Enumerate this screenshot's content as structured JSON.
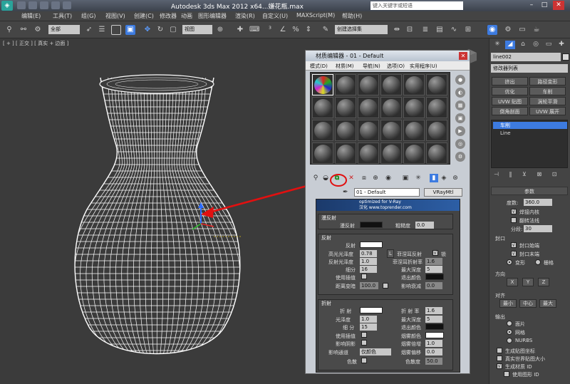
{
  "titlebar": {
    "title": "Autodesk 3ds Max  2012 x64",
    "title_tail": "...嫌花瓶.max",
    "search_placeholder": "键入关键字或短语"
  },
  "menubar": [
    "编辑(E)",
    "工具(T)",
    "组(G)",
    "视图(V)",
    "创建(C)",
    "修改器",
    "动画",
    "图形编辑器",
    "渲染(R)",
    "自定义(U)",
    "MAXScript(M)",
    "帮助(H)"
  ],
  "toolbar": {
    "selection_filter": "全部",
    "ref_coord": "视图",
    "named_sel": "创建选择集"
  },
  "viewport": {
    "label": "[ + ] [ 正交 ] [ 真实 + 边面 ]"
  },
  "material_editor": {
    "title": "材质编辑器 - 01 - Default",
    "menu": [
      "模式(D)",
      "材质(M)",
      "导航(N)",
      "选项(O)",
      "实用程序(U)"
    ],
    "material_name": "01 - Default",
    "material_type": "VRayMtl",
    "banner_line1": "optimized for V-Ray",
    "banner_line2": "汉化 www.toprender.com",
    "diffuse": {
      "header": "漫反射",
      "diffuse_label": "漫反射",
      "roughness_label": "粗糙度",
      "roughness_value": "0.0"
    },
    "reflection": {
      "header": "反射",
      "reflect_label": "反射",
      "hilight_gloss_label": "高光光泽度",
      "hilight_gloss_value": "0.78",
      "fresnel_label": "菲涅耳反射",
      "fresnel_check": "√",
      "lock_label": "L",
      "lock_label2": "锁",
      "refl_gloss_label": "反射光泽度",
      "refl_gloss_value": "1.0",
      "fresnel_ior_label": "菲涅耳折射率",
      "fresnel_ior_value": "1.6",
      "subdivs_label": "细分",
      "subdivs_value": "16",
      "max_depth_label": "最大深度",
      "max_depth_value": "5",
      "use_interp_label": "使用插值",
      "exit_color_label": "退出颜色",
      "dim_dist_label": "距离变暗",
      "dim_dist_value": "100.0",
      "dim_falloff_label": "影响衰减",
      "dim_falloff_value": "0.0"
    },
    "refraction": {
      "header": "折射",
      "refract_label": "折 射",
      "ior_label": "折 射 率",
      "ior_value": "1.6",
      "gloss_label": "光泽度",
      "gloss_value": "1.0",
      "max_depth_label": "最大深度",
      "max_depth_value": "5",
      "subdivs_label": "细 分",
      "subdivs_value": "15",
      "exit_color_label": "退出颜色",
      "use_interp_label": "使用插值",
      "fog_color_label": "烟雾颜色",
      "affect_shadows_label": "影响阴影",
      "fog_mult_label": "烟雾倍增",
      "fog_mult_value": "1.0",
      "affect_channels_label": "影响通道",
      "affect_channels_value": "仅颜色",
      "fog_bias_label": "烟雾偏移",
      "fog_bias_value": "0.0",
      "dispersion_label": "色散",
      "abbe_label": "色散度",
      "abbe_value": "50.0"
    }
  },
  "command_panel": {
    "object_name": "line002",
    "modifier_list": "修改器列表",
    "buttons": [
      "挤出",
      "路径变形",
      "优化",
      "车削",
      "UVW 贴图",
      "涡轮平滑",
      "倒角剖面",
      "UVW 展开"
    ],
    "stack": [
      "车削",
      "Line"
    ],
    "params_header": "参数",
    "degrees_label": "度数:",
    "degrees_value": "360.0",
    "weld_core_label": "焊接内核",
    "flip_normals_label": "翻转法线",
    "segments_label": "分段:",
    "segments_value": "30",
    "capping_header": "封口",
    "cap_start_label": "封口始端",
    "cap_end_label": "封口末端",
    "morph_label": "变形",
    "grid_label": "栅格",
    "direction_header": "方向",
    "dir_x": "X",
    "dir_y": "Y",
    "dir_z": "Z",
    "align_header": "对齐",
    "align_min": "最小",
    "align_center": "中心",
    "align_max": "最大",
    "output_header": "输出",
    "out_patch": "面片",
    "out_mesh": "网格",
    "out_nurbs": "NURBS",
    "gen_map_coords": "生成贴图坐标",
    "real_world_map": "真实世界贴图大小",
    "gen_mat_ids": "生成材质 ID",
    "use_shape_ids": "使用图形 ID"
  },
  "colors": {
    "background": "#3b3b3b",
    "highlight_circle": "#e11010",
    "arrow": "#e11010",
    "wireframe": "#ffffff"
  }
}
